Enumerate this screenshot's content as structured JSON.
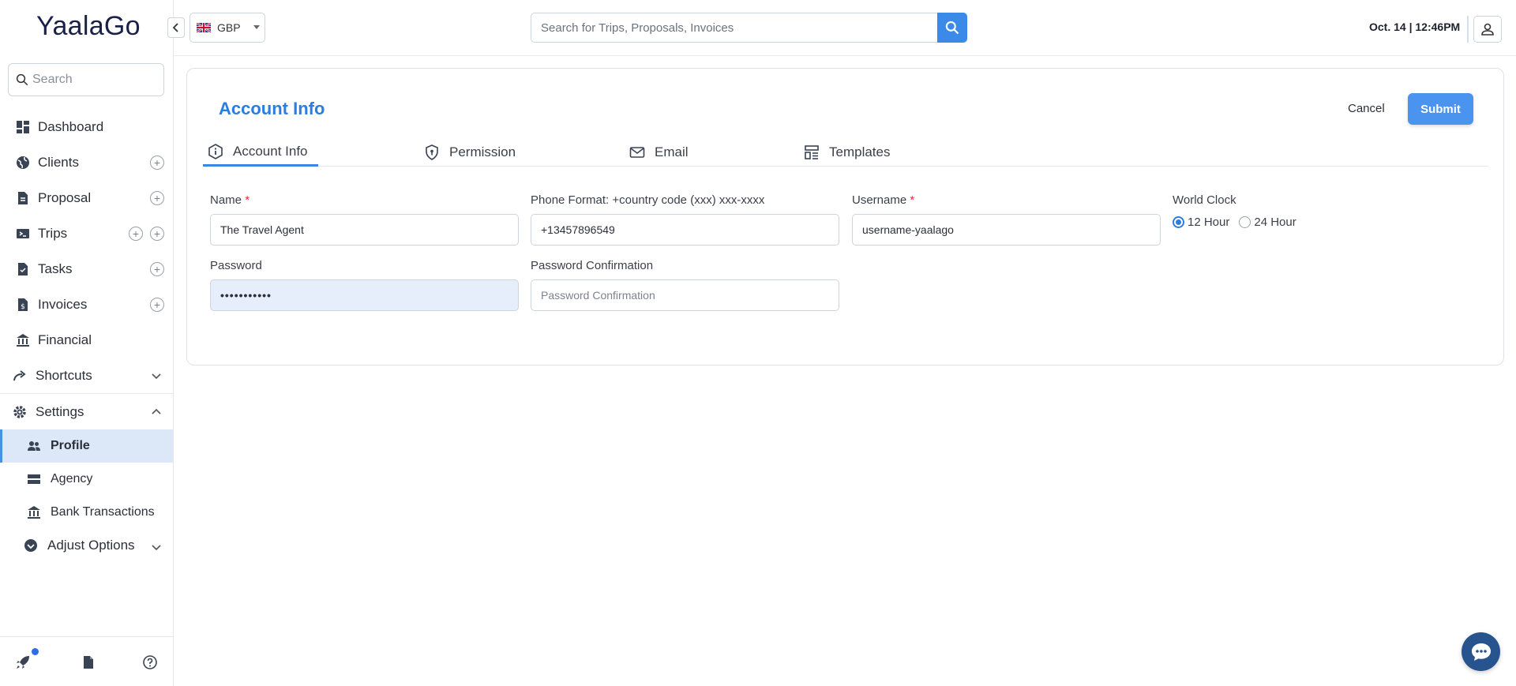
{
  "brand": {
    "logo": "YaalaGo"
  },
  "sidebar": {
    "search_placeholder": "Search",
    "items": [
      {
        "label": "Dashboard",
        "icon": "dashboard-icon"
      },
      {
        "label": "Clients",
        "icon": "globe-icon"
      },
      {
        "label": "Proposal",
        "icon": "document-icon"
      },
      {
        "label": "Trips",
        "icon": "ticket-icon"
      },
      {
        "label": "Tasks",
        "icon": "task-icon"
      },
      {
        "label": "Invoices",
        "icon": "invoice-icon"
      },
      {
        "label": "Financial",
        "icon": "bank-icon"
      },
      {
        "label": "Shortcuts",
        "icon": "shortcut-arrow-icon"
      },
      {
        "label": "Settings",
        "icon": "gear-icon"
      }
    ],
    "settings_sub": [
      {
        "label": "Profile",
        "icon": "users-icon",
        "active": true
      },
      {
        "label": "Agency",
        "icon": "server-icon"
      },
      {
        "label": "Bank Transactions",
        "icon": "bank-icon"
      },
      {
        "label": "Adjust Options",
        "icon": "check-circle-icon"
      }
    ],
    "footer_icons": [
      "rocket-icon",
      "file-icon",
      "help-icon"
    ]
  },
  "topbar": {
    "currency": "GBP",
    "search_placeholder": "Search for Trips, Proposals, Invoices",
    "datetime": "Oct. 14 | 12:46PM"
  },
  "card": {
    "title": "Account Info",
    "cancel_label": "Cancel",
    "submit_label": "Submit",
    "tabs": [
      {
        "label": "Account Info",
        "icon": "info-icon",
        "active": true
      },
      {
        "label": "Permission",
        "icon": "shield-icon"
      },
      {
        "label": "Email",
        "icon": "mail-icon"
      },
      {
        "label": "Templates",
        "icon": "template-icon"
      }
    ],
    "fields": {
      "name_label": "Name",
      "name_value": "The Travel Agent",
      "phone_label": "Phone Format: +country code (xxx) xxx-xxxx",
      "phone_value": "+13457896549",
      "username_label": "Username",
      "username_value": "username-yaalago",
      "world_clock_label": "World Clock",
      "clock_12": "12 Hour",
      "clock_24": "24 Hour",
      "password_label": "Password",
      "password_value": "•••••••••••",
      "password_confirm_label": "Password Confirmation",
      "password_confirm_placeholder": "Password Confirmation"
    },
    "required_mark": "*"
  },
  "colors": {
    "accent": "#2b7de0",
    "button": "#4a93ee",
    "active_bg": "#dce8f7",
    "chat": "#27548f"
  }
}
